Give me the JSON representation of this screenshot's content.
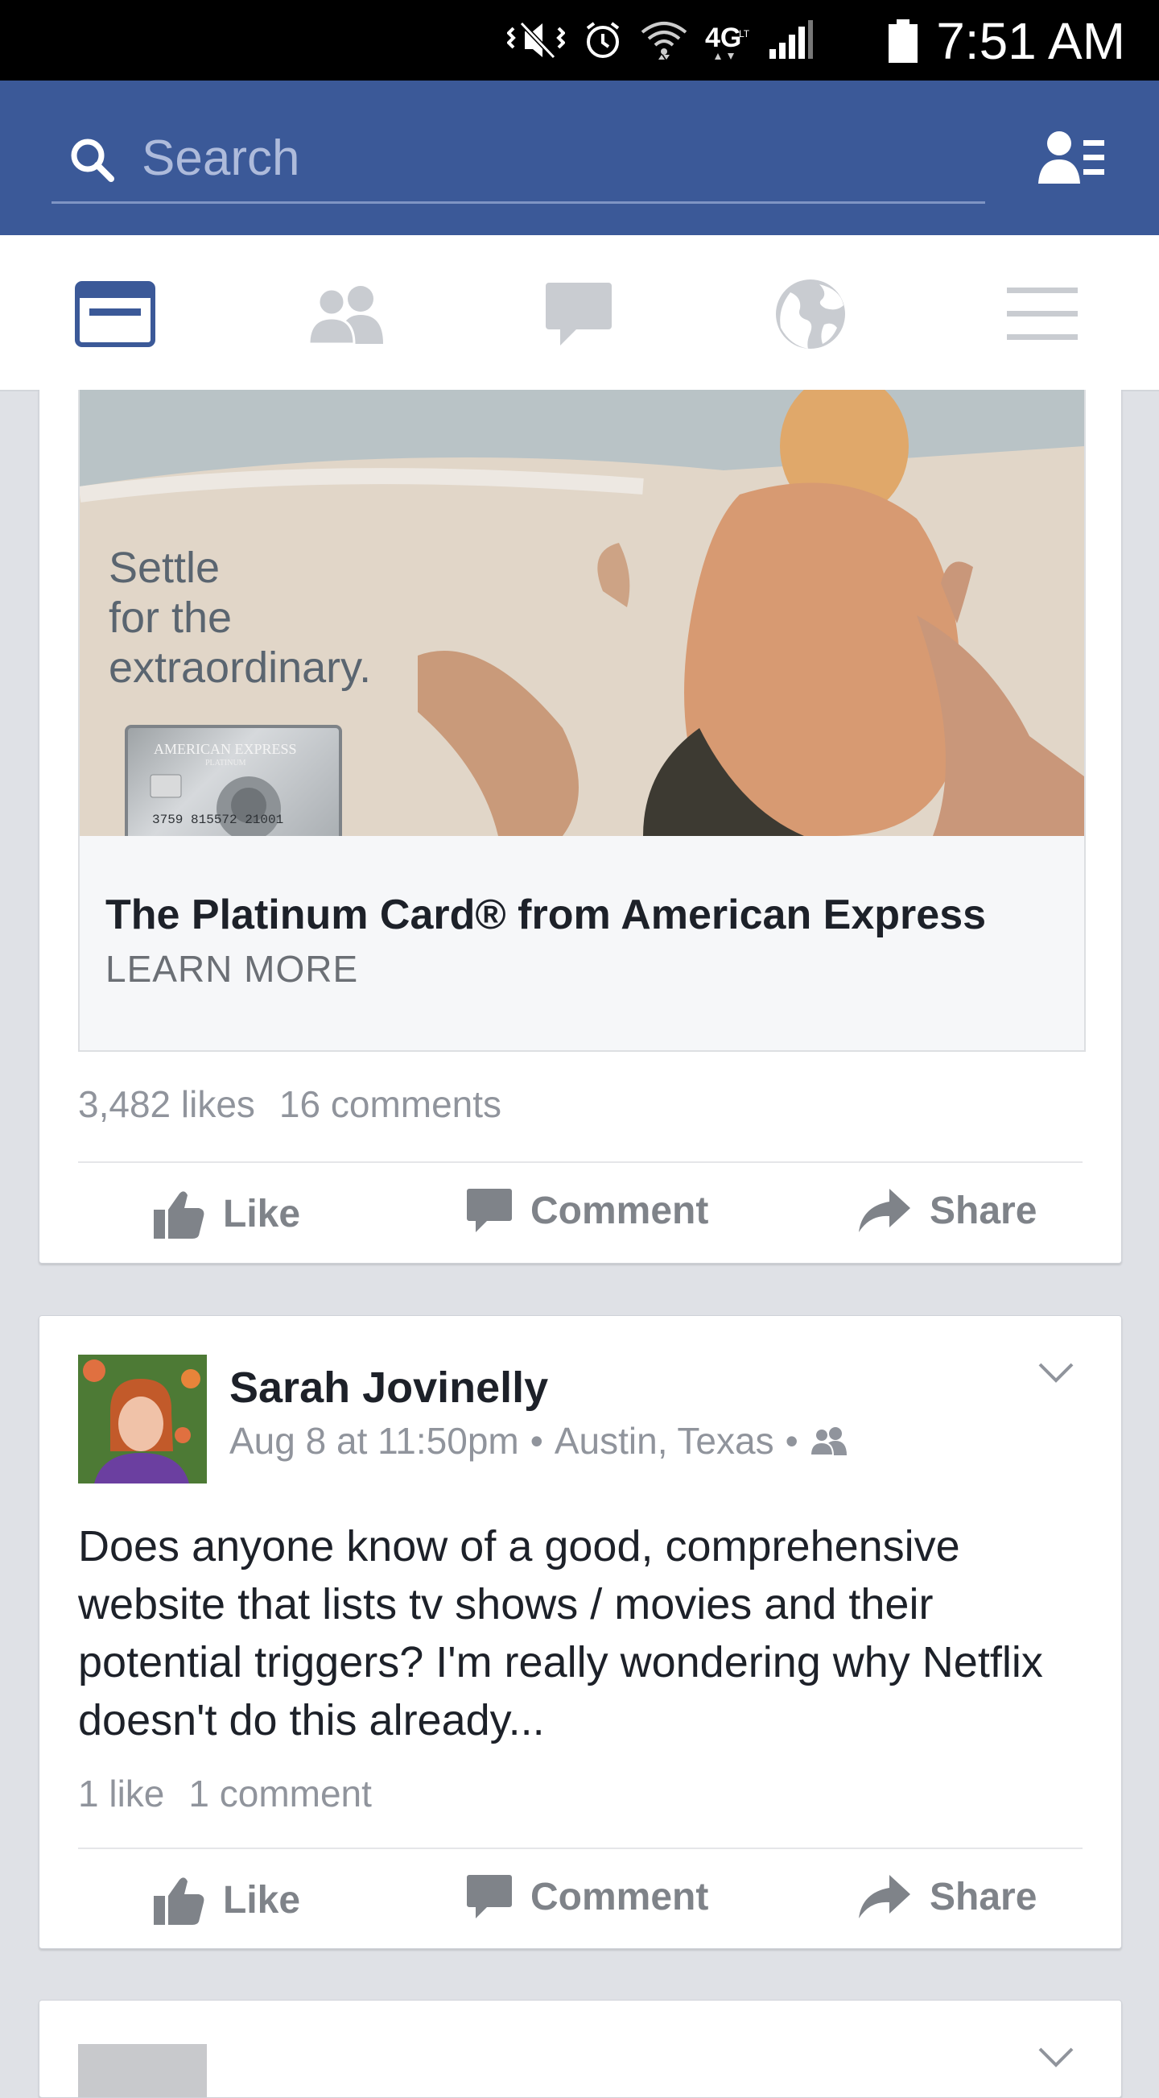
{
  "status_bar": {
    "time": "7:51 AM",
    "network": "4G LTE",
    "icons": [
      "mute-vibrate-icon",
      "alarm-icon",
      "wifi-icon",
      "4g-lte-icon",
      "signal-icon",
      "battery-icon"
    ]
  },
  "header": {
    "search_placeholder": "Search",
    "brand_color": "#3b5998"
  },
  "tabs": [
    {
      "name": "news-feed",
      "icon": "news-feed-icon",
      "active": true
    },
    {
      "name": "friend-requests",
      "icon": "friends-icon",
      "active": false
    },
    {
      "name": "messages",
      "icon": "message-icon",
      "active": false
    },
    {
      "name": "notifications",
      "icon": "globe-icon",
      "active": false
    },
    {
      "name": "more",
      "icon": "menu-icon",
      "active": false
    }
  ],
  "ad_post": {
    "image_tagline": "Settle for the extraordinary.",
    "card_brand": "AMERICAN EXPRESS",
    "card_tier": "PLATINUM",
    "card_number": "3759 815572 21001",
    "title": "The Platinum Card® from American Express",
    "cta": "LEARN MORE",
    "likes": "3,482 likes",
    "comments": "16 comments",
    "actions": {
      "like": "Like",
      "comment": "Comment",
      "share": "Share"
    }
  },
  "post": {
    "author": "Sarah Jovinelly",
    "time": "Aug 8 at 11:50pm",
    "separator": "•",
    "location": "Austin, Texas",
    "text": "Does anyone know of a good, comprehensive website that lists tv shows / movies and their potential triggers?  I'm really wondering why Netflix doesn't do this already...",
    "likes": "1 like",
    "comments": "1 comment",
    "actions": {
      "like": "Like",
      "comment": "Comment",
      "share": "Share"
    }
  },
  "colors": {
    "accent": "#3b5998",
    "text_dark": "#1d2129",
    "text_muted": "#90949c",
    "action_gray": "#7f8389",
    "page_bg": "#dfe1e6"
  }
}
